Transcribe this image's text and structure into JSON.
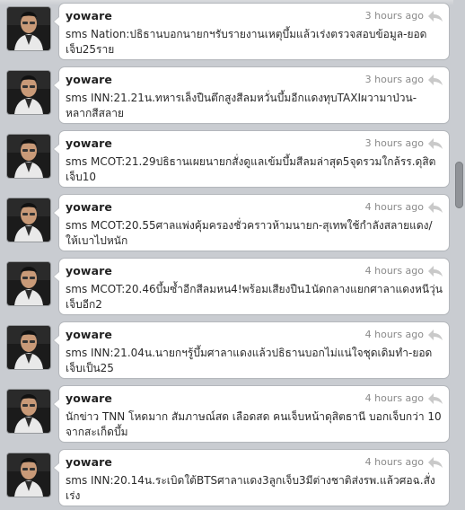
{
  "tweets": [
    {
      "username": "yoware",
      "time": "3 hours ago",
      "text": "sms Nation:ปธิธานบอกนายกฯรับรายงานเหตุบึ้มแล้วเร่งตรวจสอบข้อมูล-ยอดเจ็บ25ราย"
    },
    {
      "username": "yoware",
      "time": "3 hours ago",
      "text": "sms INN:21.21น.ทหารเล็งปืนตึกสูงสีลมหวั่นบึ้มอีกแดงทุบTAXIผวามาป่วน-หลากสีสลาย"
    },
    {
      "username": "yoware",
      "time": "3 hours ago",
      "text": "sms MCOT:21.29ปธิธานเผยนายกสั่งดูแลเข้มบึ้มสีลมล่าสุด5จุดรวมใกล้รร.ดุสิตเจ็บ10"
    },
    {
      "username": "yoware",
      "time": "4 hours ago",
      "text": "sms MCOT:20.55ศาลแพ่งคุ้มครองชั่วคราวห้ามนายก-สุเทพใช้กำลังสลายแดง/ให้เบาไปหนัก"
    },
    {
      "username": "yoware",
      "time": "4 hours ago",
      "text": "sms MCOT:20.46บึ้มซ้ำอีกสีลมหน4!พร้อมเสียงปืน1นัดกลางแยกศาลาแดงหนีวุ่นเจ็บอีก2"
    },
    {
      "username": "yoware",
      "time": "4 hours ago",
      "text": "sms INN:21.04น.นายกฯรู้บึ้มศาลาแดงแล้วปธิธานบอกไม่แน่ใจชุดเดิมทำ-ยอดเจ็บเป็น25"
    },
    {
      "username": "yoware",
      "time": "4 hours ago",
      "text": "นักข่าว TNN โหดมาก สัมภาษณ์สด เลือดสด คนเจ็บหน้าดุสิตธานี บอกเจ็บกว่า 10 จากสะเก็ดบึ้ม"
    },
    {
      "username": "yoware",
      "time": "4 hours ago",
      "text": "sms INN:20.14น.ระเบิดใต้BTSศาลาแดง3ลูกเจ็บ3มีต่างชาติส่งรพ.แล้วศอฉ.สั่งเร่ง"
    }
  ],
  "icons": {
    "reply": "reply-arrow-icon",
    "avatar": "user-avatar"
  }
}
